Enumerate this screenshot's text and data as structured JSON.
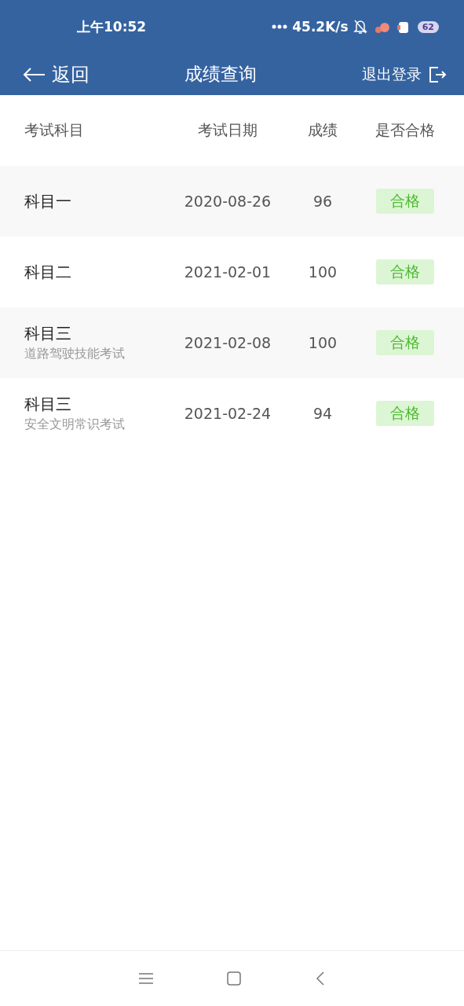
{
  "status_bar": {
    "time": "上午10:52",
    "network_speed": "45.2K/s",
    "battery": "62"
  },
  "header": {
    "back": "返回",
    "title": "成绩查询",
    "logout": "退出登录"
  },
  "table": {
    "columns": [
      "考试科目",
      "考试日期",
      "成绩",
      "是否合格"
    ],
    "rows": [
      {
        "subject": "科目一",
        "date": "2020-08-26",
        "score": "96",
        "result": "合格",
        "passed": true
      },
      {
        "subject": "科目二",
        "date": "2021-02-01",
        "score": "100",
        "result": "合格",
        "passed": true
      },
      {
        "subject": "科目三",
        "subtitle": "道路驾驶技能考试",
        "date": "2021-02-08",
        "score": "100",
        "result": "合格",
        "passed": true
      },
      {
        "subject": "科目三",
        "subtitle": "安全文明常识考试",
        "date": "2021-02-24",
        "score": "94",
        "result": "合格",
        "passed": true
      }
    ]
  }
}
